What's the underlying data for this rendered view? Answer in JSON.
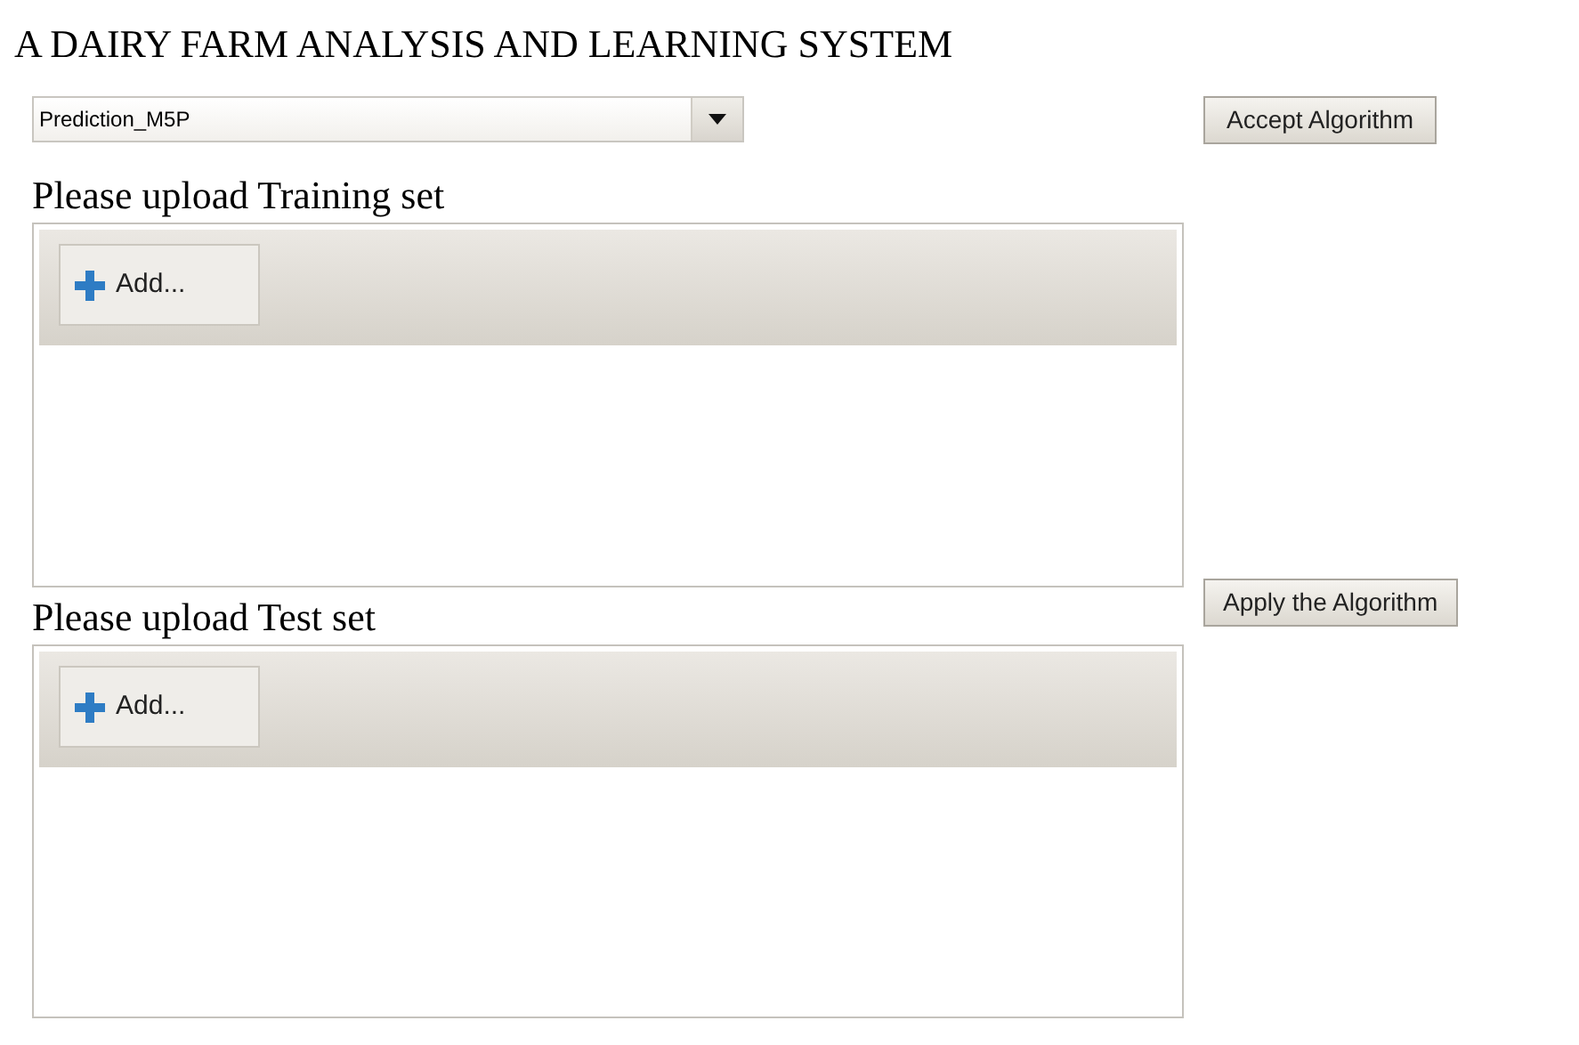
{
  "title": "A DAIRY FARM ANALYSIS AND LEARNING SYSTEM",
  "algorithm_select": {
    "value": "Prediction_M5P"
  },
  "accept_button": "Accept Algorithm",
  "uploads": [
    {
      "label": "Please upload Training set",
      "add_button": "Add..."
    },
    {
      "label": "Please upload Test set",
      "add_button": "Add..."
    }
  ],
  "apply_button": "Apply the Algorithm"
}
